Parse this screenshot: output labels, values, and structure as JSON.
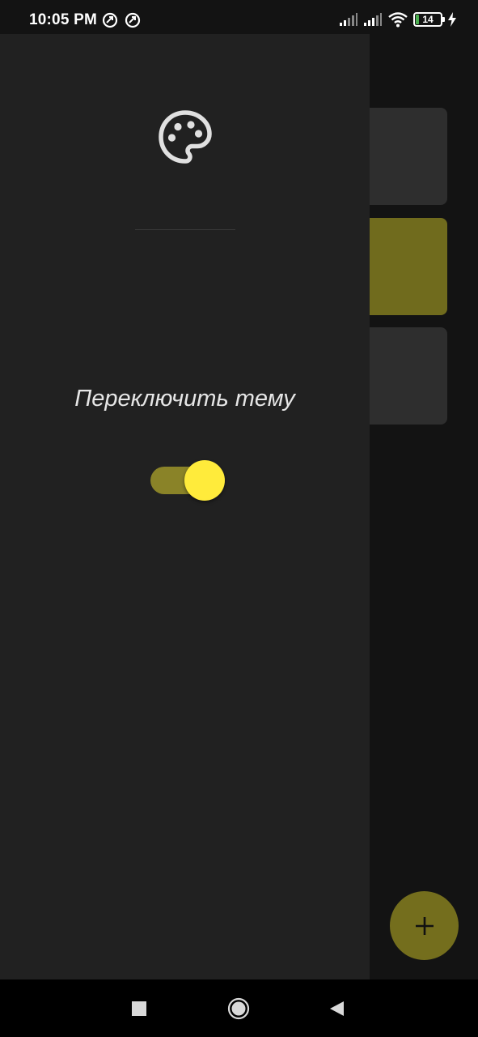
{
  "status_bar": {
    "time": "10:05 PM",
    "battery_level": "14",
    "left_icons": [
      "notification-app-icon",
      "notification-app-icon"
    ],
    "right_icons": [
      "signal-icon",
      "signal-icon",
      "wifi-icon",
      "battery-icon",
      "charging-icon"
    ]
  },
  "drawer": {
    "header_icon": "palette-icon",
    "theme_toggle_label": "Переключить тему",
    "theme_toggle_on": true
  },
  "background": {
    "cards": [
      {
        "color": "#2e2e2e"
      },
      {
        "color": "#706b1d"
      },
      {
        "color": "#2e2e2e"
      }
    ],
    "fab_icon": "plus-icon"
  },
  "nav_bar": {
    "buttons": [
      "recents-icon",
      "home-icon",
      "back-icon"
    ]
  },
  "colors": {
    "accent": "#ffeb3b",
    "accent_dark": "#746e1d",
    "drawer_bg": "#212121",
    "screen_bg": "#131313"
  }
}
